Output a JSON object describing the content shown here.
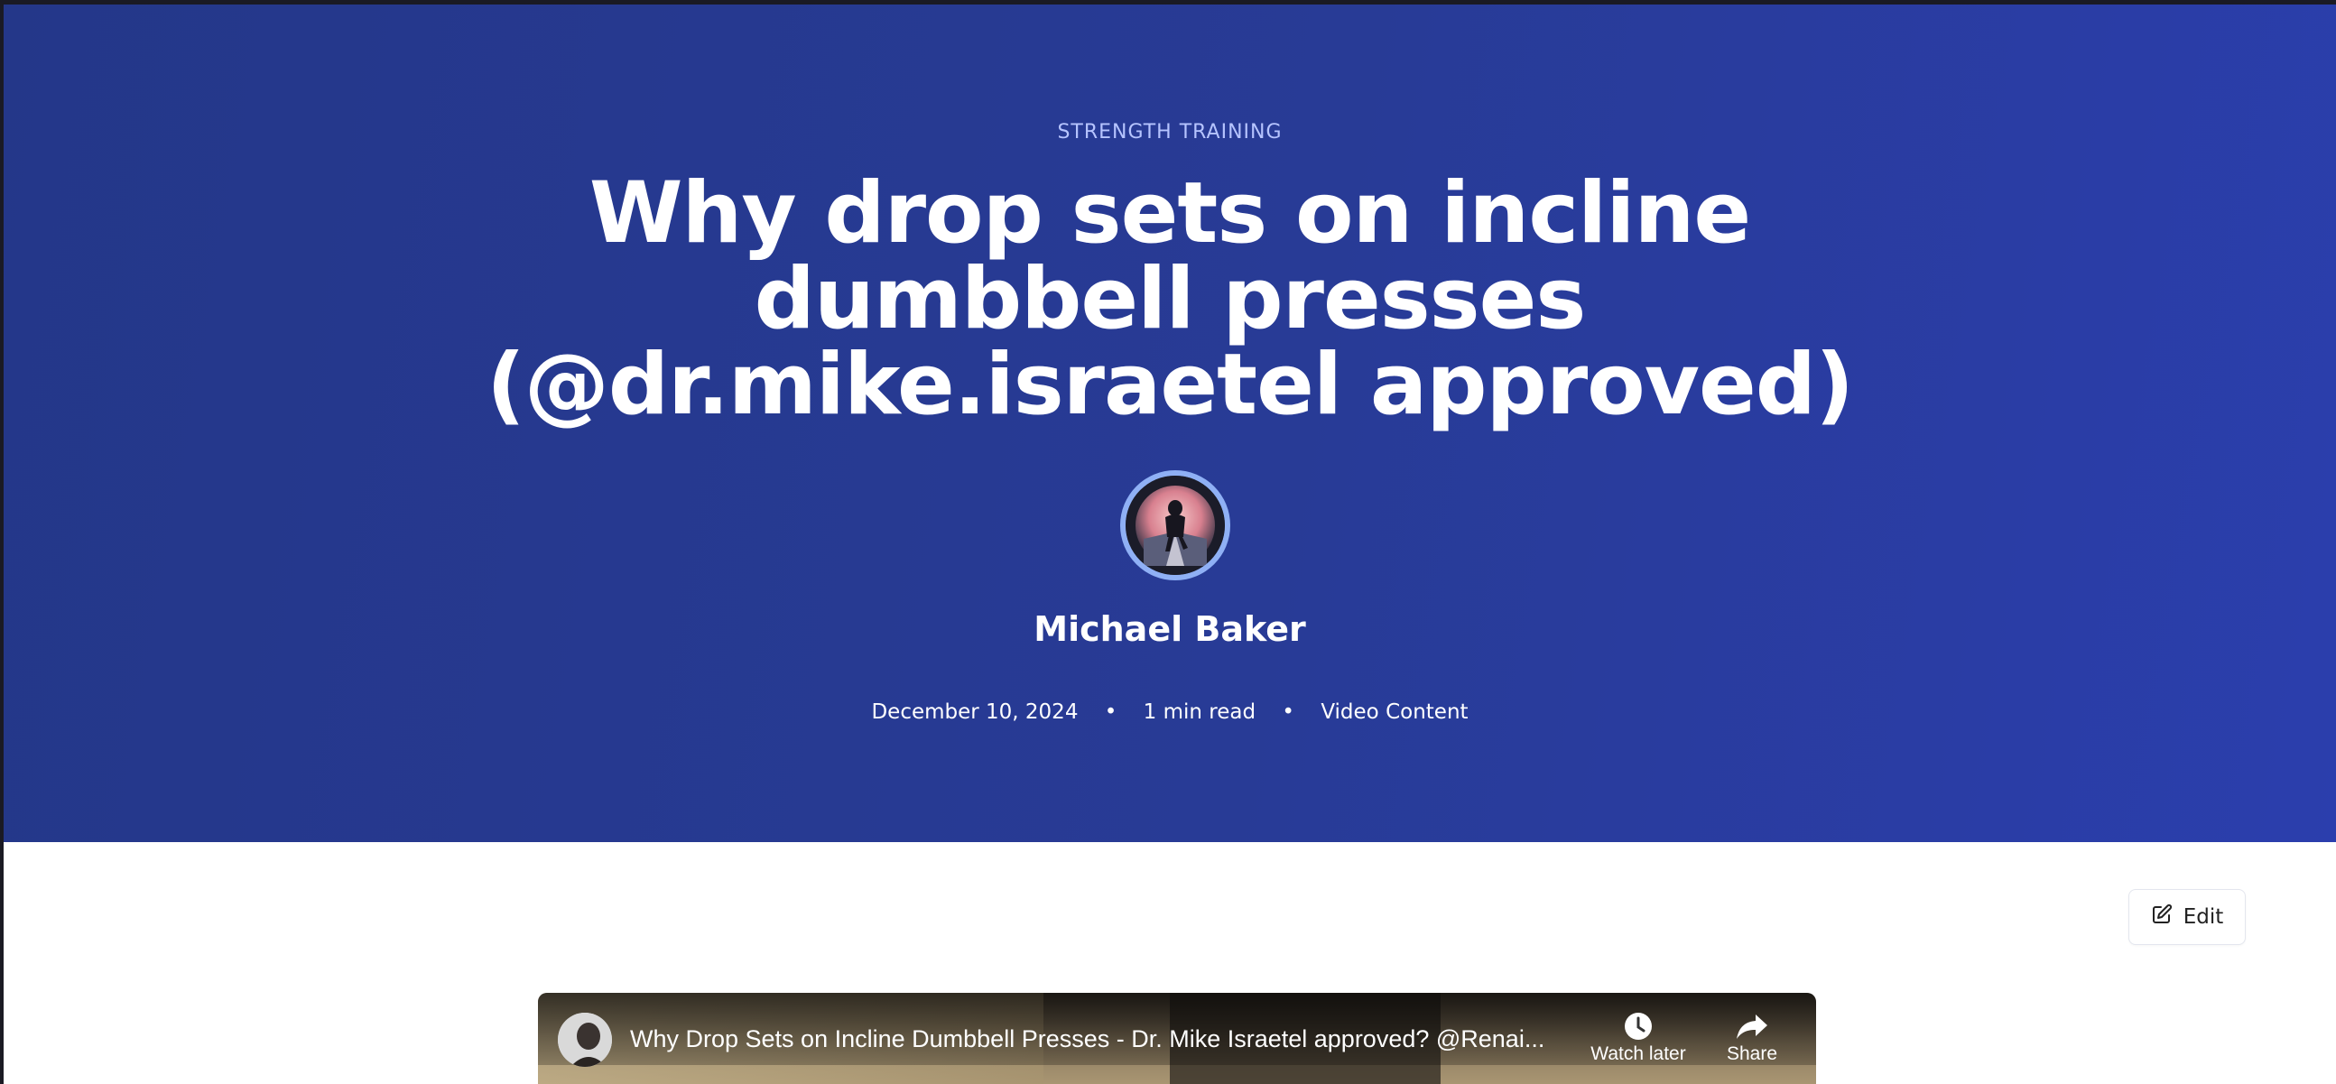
{
  "hero": {
    "category": "STRENGTH TRAINING",
    "title_lines": [
      "Why drop sets on incline",
      "dumbbell presses",
      "(@dr.mike.israetel approved)"
    ],
    "author": "Michael Baker",
    "meta": {
      "date": "December 10, 2024",
      "separator": "•",
      "read_time": "1 min read",
      "content_type": "Video Content"
    }
  },
  "toolbar": {
    "edit_label": "Edit"
  },
  "video": {
    "title": "Why Drop Sets on Incline Dumbbell Presses - Dr. Mike Israetel approved? @Renai...",
    "watch_later_label": "Watch later",
    "share_label": "Share"
  },
  "colors": {
    "hero_bg": "#283b96",
    "category_text": "#b6c4ff",
    "avatar_ring": "#8fb0f5"
  },
  "icons": {
    "edit": "edit-icon",
    "clock": "clock-icon",
    "share": "share-arrow-icon"
  }
}
